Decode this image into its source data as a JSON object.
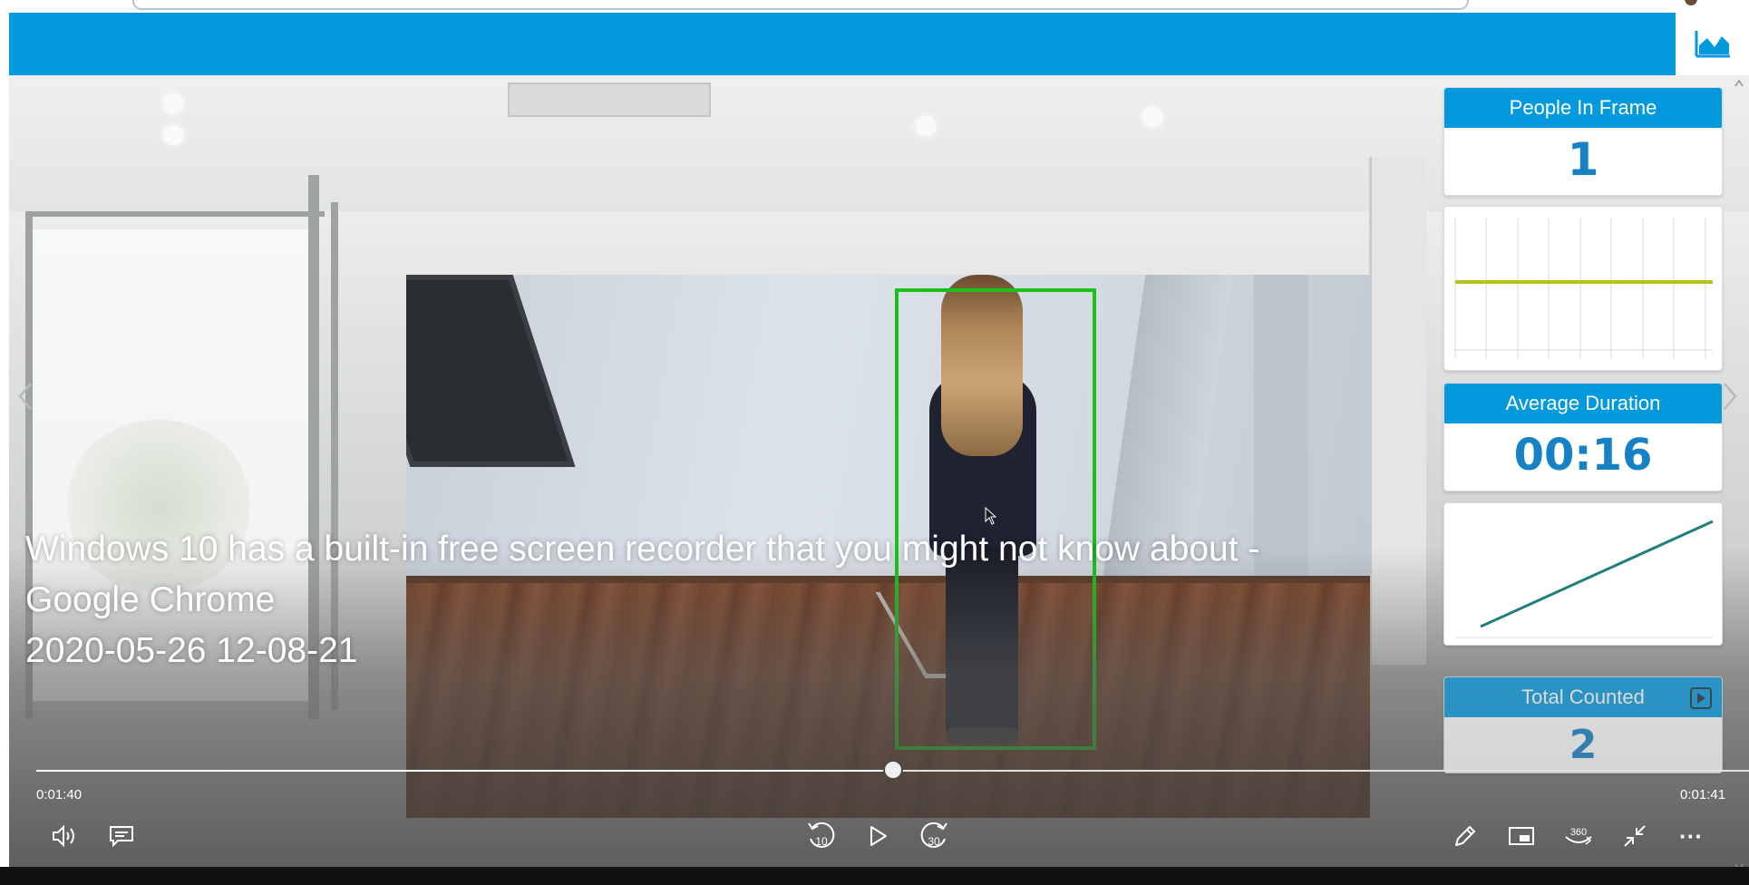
{
  "window": {
    "title": ""
  },
  "panel": {
    "people_in_frame": {
      "title": "People In Frame",
      "value": "1"
    },
    "average_duration": {
      "title": "Average Duration",
      "value": "00:16"
    },
    "total_counted": {
      "title": "Total Counted",
      "value": "2"
    }
  },
  "video": {
    "caption_line1": "Windows 10 has a built-in free screen recorder that you might not know about - Google Chrome",
    "caption_line2": "2020-05-26 12-08-21",
    "current_time": "0:01:40",
    "total_time": "0:01:41",
    "progress_fraction": 0.5
  },
  "controls": {
    "skip_back_label": "10",
    "skip_forward_label": "30",
    "view_360_label": "360",
    "more_label": "···"
  },
  "colors": {
    "header_blue": "#0399dd",
    "value_blue": "#1681c4",
    "detection_green": "#17c317",
    "trend_line": "#1f7f7c",
    "flat_line": "#b6c21f"
  },
  "icons": {
    "chart_toggle": "area-chart-icon",
    "volume": "volume-icon",
    "subtitles": "subtitles-icon",
    "play": "play-icon",
    "edit": "pencil-icon",
    "mini_view": "mini-view-icon",
    "fullscreen_exit": "exit-fullscreen-icon"
  }
}
